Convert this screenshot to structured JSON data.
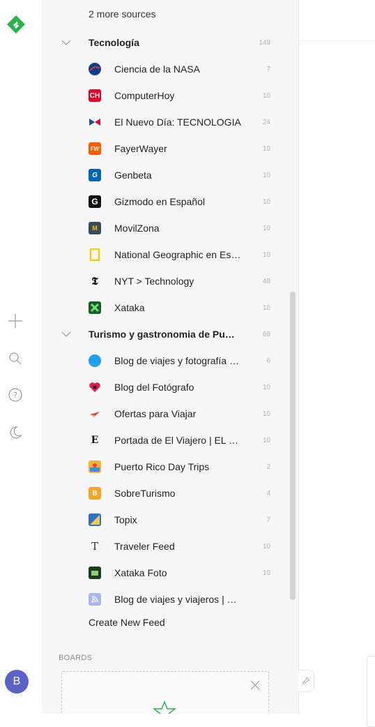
{
  "sidebar": {
    "more_sources": "2 more sources",
    "categories": [
      {
        "name": "Tecnología",
        "count": "149",
        "feeds": [
          {
            "name": "Ciencia de la NASA",
            "count": "7",
            "icon": "nasa-icon"
          },
          {
            "name": "ComputerHoy",
            "count": "10",
            "icon": "computerhoy-icon"
          },
          {
            "name": "El Nuevo Día: TECNOLOGIA",
            "count": "24",
            "icon": "el-nuevo-dia-icon"
          },
          {
            "name": "FayerWayer",
            "count": "10",
            "icon": "fayerwayer-icon"
          },
          {
            "name": "Genbeta",
            "count": "10",
            "icon": "genbeta-icon"
          },
          {
            "name": "Gizmodo en Español",
            "count": "10",
            "icon": "gizmodo-icon"
          },
          {
            "name": "MovilZona",
            "count": "10",
            "icon": "movilzona-icon"
          },
          {
            "name": "National Geographic en Es…",
            "count": "10",
            "icon": "natgeo-icon"
          },
          {
            "name": "NYT > Technology",
            "count": "48",
            "icon": "nyt-icon"
          },
          {
            "name": "Xataka",
            "count": "10",
            "icon": "xataka-icon"
          }
        ]
      },
      {
        "name": "Turismo y gastronomia de Pu…",
        "count": "69",
        "feeds": [
          {
            "name": "Blog de viajes y fotografía …",
            "count": "6",
            "icon": "blue-circle-icon"
          },
          {
            "name": "Blog del Fotógrafo",
            "count": "10",
            "icon": "heart-camera-icon"
          },
          {
            "name": "Ofertas para Viajar",
            "count": "10",
            "icon": "plane-icon"
          },
          {
            "name": "Portada de El Viajero | EL …",
            "count": "10",
            "icon": "el-pais-icon"
          },
          {
            "name": "Puerto Rico Day Trips",
            "count": "2",
            "icon": "prdaytrips-icon"
          },
          {
            "name": "SobreTurismo",
            "count": "4",
            "icon": "sobreturismo-icon"
          },
          {
            "name": "Topix",
            "count": "7",
            "icon": "topix-icon"
          },
          {
            "name": "Traveler Feed",
            "count": "10",
            "icon": "traveler-icon"
          },
          {
            "name": "Xataka Foto",
            "count": "10",
            "icon": "xataka-foto-icon"
          },
          {
            "name": "Blog de viajes y viajeros | …",
            "count": "",
            "icon": "rss-icon"
          }
        ]
      }
    ],
    "create_feed": "Create New Feed",
    "boards_label": "BOARDS"
  },
  "rail": {
    "avatar_initial": "B",
    "icons": [
      "feedly-logo-icon",
      "add-icon",
      "search-icon",
      "help-icon",
      "night-mode-icon"
    ]
  },
  "colors": {
    "brand_green": "#2bb24c",
    "avatar": "#5b63c9",
    "panel_bg": "#f7f7f7"
  }
}
